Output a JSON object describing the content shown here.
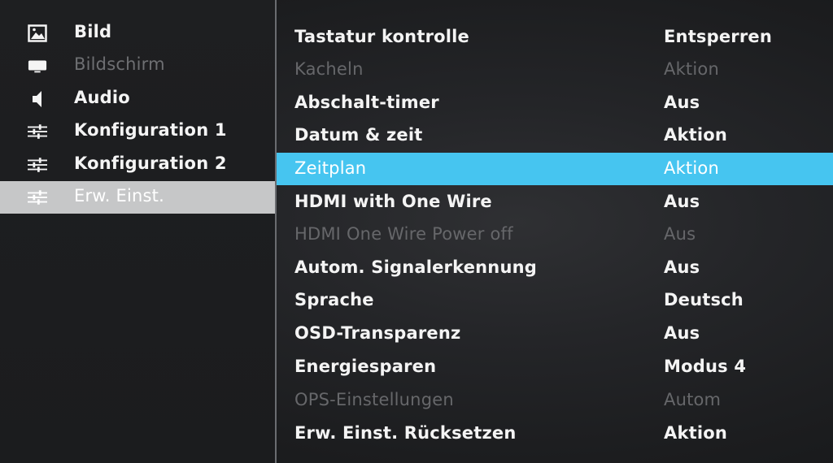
{
  "sidebar": {
    "items": [
      {
        "label": "Bild",
        "icon": "picture-icon",
        "state": "normal"
      },
      {
        "label": "Bildschirm",
        "icon": "monitor-icon",
        "state": "disabled"
      },
      {
        "label": "Audio",
        "icon": "speaker-icon",
        "state": "normal"
      },
      {
        "label": "Konfiguration 1",
        "icon": "sliders-icon",
        "state": "normal"
      },
      {
        "label": "Konfiguration 2",
        "icon": "sliders-icon",
        "state": "normal"
      },
      {
        "label": "Erw. Einst.",
        "icon": "sliders-icon",
        "state": "selected"
      }
    ]
  },
  "menu": {
    "rows": [
      {
        "label": "Tastatur kontrolle",
        "value": "Entsperren",
        "state": "normal"
      },
      {
        "label": "Kacheln",
        "value": "Aktion",
        "state": "disabled"
      },
      {
        "label": "Abschalt-timer",
        "value": "Aus",
        "state": "normal"
      },
      {
        "label": "Datum & zeit",
        "value": "Aktion",
        "state": "normal"
      },
      {
        "label": "Zeitplan",
        "value": "Aktion",
        "state": "highlight"
      },
      {
        "label": "HDMI with One Wire",
        "value": "Aus",
        "state": "normal"
      },
      {
        "label": "HDMI One Wire Power off",
        "value": "Aus",
        "state": "disabled"
      },
      {
        "label": "Autom. Signalerkennung",
        "value": "Aus",
        "state": "normal"
      },
      {
        "label": "Sprache",
        "value": "Deutsch",
        "state": "normal"
      },
      {
        "label": "OSD-Transparenz",
        "value": "Aus",
        "state": "normal"
      },
      {
        "label": "Energiesparen",
        "value": "Modus 4",
        "state": "normal"
      },
      {
        "label": "OPS-Einstellungen",
        "value": "Autom",
        "state": "disabled"
      },
      {
        "label": "Erw. Einst. Rücksetzen",
        "value": "Aktion",
        "state": "normal"
      }
    ]
  },
  "colors": {
    "highlight": "#46c5f0",
    "selected_sidebar": "#c6c7c8",
    "text": "#f4f4f4",
    "disabled_text": "#66676a"
  }
}
